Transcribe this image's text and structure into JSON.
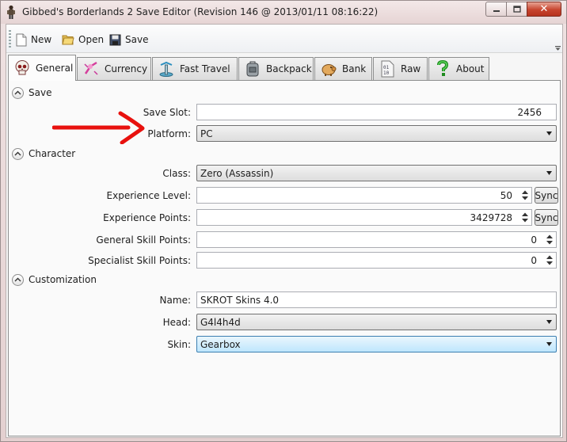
{
  "window": {
    "title": "Gibbed's Borderlands 2 Save Editor (Revision 146 @ 2013/01/11 08:16:22)",
    "icon": "app-figure-icon",
    "buttons": [
      "minimize",
      "maximize",
      "close"
    ]
  },
  "toolbar": {
    "new_label": "New",
    "open_label": "Open",
    "save_label": "Save"
  },
  "tabs": [
    {
      "label": "General",
      "icon": "skull-icon",
      "active": true
    },
    {
      "label": "Currency",
      "icon": "currency-icon",
      "active": false
    },
    {
      "label": "Fast Travel",
      "icon": "fast-travel-icon",
      "active": false
    },
    {
      "label": "Backpack",
      "icon": "backpack-icon",
      "active": false
    },
    {
      "label": "Bank",
      "icon": "piggy-bank-icon",
      "active": false
    },
    {
      "label": "Raw",
      "icon": "raw-file-icon",
      "active": false
    },
    {
      "label": "About",
      "icon": "about-question-icon",
      "active": false
    }
  ],
  "sections": {
    "save": {
      "header": "Save",
      "save_slot_label": "Save Slot:",
      "save_slot_value": "2456",
      "platform_label": "Platform:",
      "platform_value": "PC"
    },
    "character": {
      "header": "Character",
      "class_label": "Class:",
      "class_value": "Zero (Assassin)",
      "exp_level_label": "Experience Level:",
      "exp_level_value": "50",
      "exp_points_label": "Experience Points:",
      "exp_points_value": "3429728",
      "general_skill_label": "General Skill Points:",
      "general_skill_value": "0",
      "specialist_skill_label": "Specialist Skill Points:",
      "specialist_skill_value": "0",
      "sync_label": "Sync"
    },
    "customization": {
      "header": "Customization",
      "name_label": "Name:",
      "name_value": "SKROT Skins 4.0",
      "head_label": "Head:",
      "head_value": "G4l4h4d",
      "skin_label": "Skin:",
      "skin_value": "Gearbox"
    }
  },
  "colors": {
    "annotation_arrow": "#e8110e",
    "combo_hot": "#bee6fd",
    "close_button": "#c7442e"
  }
}
